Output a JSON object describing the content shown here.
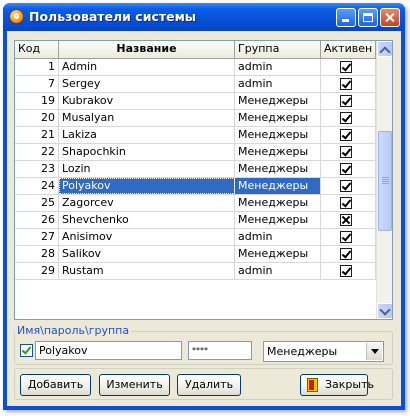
{
  "window": {
    "title": "Пользователи системы",
    "icons": {
      "app": "app-logo-icon",
      "minimize": "minimize-icon",
      "maximize": "maximize-icon",
      "close": "close-icon"
    }
  },
  "grid": {
    "headers": {
      "id": "Код",
      "name": "Название",
      "group": "Группа",
      "active": "Активен"
    },
    "rows": [
      {
        "id": "1",
        "name": "Admin",
        "group": "admin",
        "active": true,
        "selected": false
      },
      {
        "id": "7",
        "name": "Sergey",
        "group": "admin",
        "active": true,
        "selected": false
      },
      {
        "id": "19",
        "name": "Kubrakov",
        "group": "Менеджеры",
        "active": true,
        "selected": false
      },
      {
        "id": "20",
        "name": "Musalyan",
        "group": "Менеджеры",
        "active": true,
        "selected": false
      },
      {
        "id": "21",
        "name": "Lakiza",
        "group": "Менеджеры",
        "active": true,
        "selected": false
      },
      {
        "id": "22",
        "name": "Shapochkin",
        "group": "Менеджеры",
        "active": true,
        "selected": false
      },
      {
        "id": "23",
        "name": "Lozin",
        "group": "Менеджеры",
        "active": true,
        "selected": false
      },
      {
        "id": "24",
        "name": "Polyakov",
        "group": "Менеджеры",
        "active": true,
        "selected": true
      },
      {
        "id": "25",
        "name": "Zagorcev",
        "group": "Менеджеры",
        "active": true,
        "selected": false
      },
      {
        "id": "26",
        "name": "Shevchenko",
        "group": "Менеджеры",
        "active": false,
        "selected": false
      },
      {
        "id": "27",
        "name": "Anisimov",
        "group": "admin",
        "active": true,
        "selected": false
      },
      {
        "id": "28",
        "name": "Salikov",
        "group": "Менеджеры",
        "active": true,
        "selected": false
      },
      {
        "id": "29",
        "name": "Rustam",
        "group": "admin",
        "active": true,
        "selected": false
      }
    ]
  },
  "form": {
    "group_label": "Имя\\пароль\\группа",
    "active_checked": true,
    "name_value": "Polyakov",
    "password_value": "****",
    "group_value": "Менеджеры"
  },
  "buttons": {
    "add": "Добавить",
    "edit": "Изменить",
    "delete": "Удалить",
    "close": "Закрыть",
    "close_icon": "exit-door-icon"
  },
  "colors": {
    "selection": "#316ac5",
    "titlebar": "#0850d8",
    "face": "#ece9d8"
  }
}
